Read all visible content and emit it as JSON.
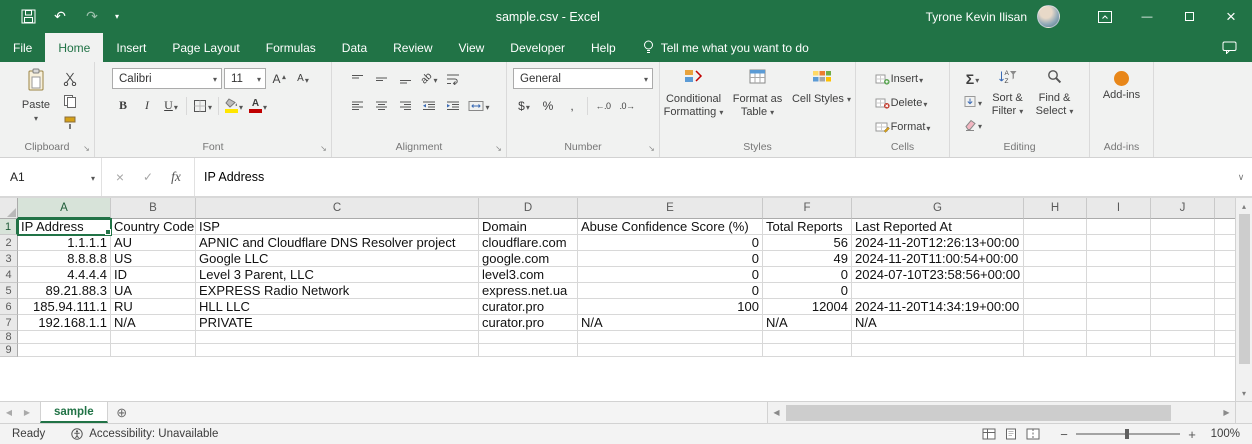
{
  "colors": {
    "excel_green": "#217346",
    "fill_yellow": "#ffe600",
    "font_color_red": "#c00000",
    "addins_orange": "#e8871a"
  },
  "window": {
    "title": "sample.csv - Excel",
    "user": "Tyrone Kevin Ilisan"
  },
  "ribbon_tabs": [
    "File",
    "Home",
    "Insert",
    "Page Layout",
    "Formulas",
    "Data",
    "Review",
    "View",
    "Developer",
    "Help"
  ],
  "active_tab": "Home",
  "tell_me": "Tell me what you want to do",
  "ribbon": {
    "clipboard": {
      "label": "Clipboard",
      "paste": "Paste"
    },
    "font": {
      "label": "Font",
      "family": "Calibri",
      "size": "11",
      "bold": "B",
      "italic": "I",
      "underline": "U",
      "grow": "A",
      "shrink": "A"
    },
    "alignment": {
      "label": "Alignment",
      "orientation": "ab"
    },
    "number": {
      "label": "Number",
      "format": "General",
      "currency": "$",
      "percent": "%",
      "comma": ",",
      "increase_decimal": "←.0",
      "decrease_decimal": ".0→"
    },
    "styles": {
      "label": "Styles",
      "conditional_formatting": "Conditional Formatting",
      "format_as_table": "Format as Table",
      "cell_styles": "Cell Styles"
    },
    "cells": {
      "label": "Cells",
      "insert": "Insert",
      "delete": "Delete",
      "format": "Format"
    },
    "editing": {
      "label": "Editing",
      "autosum": "Σ",
      "sort_filter": "Sort & Filter",
      "find_select": "Find & Select"
    },
    "addins": {
      "label": "Add-ins",
      "button": "Add-ins"
    }
  },
  "formula_bar": {
    "name_box": "A1",
    "fx": "fx",
    "content": "IP Address"
  },
  "sheet": {
    "selected_cell": "A1",
    "column_headers": [
      "A",
      "B",
      "C",
      "D",
      "E",
      "F",
      "G",
      "H",
      "I",
      "J"
    ],
    "rows": [
      [
        "IP Address",
        "Country Code",
        "ISP",
        "Domain",
        "Abuse Confidence Score (%)",
        "Total Reports",
        "Last Reported At",
        "",
        "",
        ""
      ],
      [
        "1.1.1.1",
        "AU",
        "APNIC and Cloudflare DNS Resolver project",
        "cloudflare.com",
        "0",
        "56",
        "2024-11-20T12:26:13+00:00",
        "",
        "",
        ""
      ],
      [
        "8.8.8.8",
        "US",
        "Google LLC",
        "google.com",
        "0",
        "49",
        "2024-11-20T11:00:54+00:00",
        "",
        "",
        ""
      ],
      [
        "4.4.4.4",
        "ID",
        "Level 3 Parent, LLC",
        "level3.com",
        "0",
        "0",
        "2024-07-10T23:58:56+00:00",
        "",
        "",
        ""
      ],
      [
        "89.21.88.3",
        "UA",
        "EXPRESS Radio Network",
        "express.net.ua",
        "0",
        "0",
        "",
        "",
        "",
        ""
      ],
      [
        "185.94.111.1",
        "RU",
        "HLL LLC",
        "curator.pro",
        "100",
        "12004",
        "2024-11-20T14:34:19+00:00",
        "",
        "",
        ""
      ],
      [
        "192.168.1.1",
        "N/A",
        "PRIVATE",
        "curator.pro",
        "N/A",
        "N/A",
        "N/A",
        "",
        "",
        ""
      ],
      [
        "",
        "",
        "",
        "",
        "",
        "",
        "",
        "",
        "",
        ""
      ],
      [
        "",
        "",
        "",
        "",
        "",
        "",
        "",
        "",
        "",
        ""
      ]
    ]
  },
  "sheet_tabs": {
    "active": "sample"
  },
  "status_bar": {
    "mode": "Ready",
    "accessibility": "Accessibility: Unavailable",
    "zoom": "100%"
  }
}
